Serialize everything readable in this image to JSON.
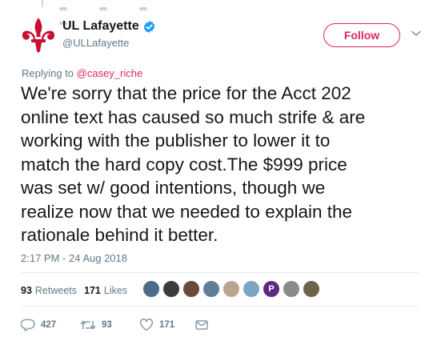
{
  "account": {
    "name": "UL Lafayette",
    "handle": "@ULLafayette",
    "verified": true,
    "follow_label": "Follow",
    "accent": "#e0245e"
  },
  "reply": {
    "prefix": "Replying to",
    "mention": "@casey_riche"
  },
  "tweet": {
    "text": "We're sorry that the price for the Acct 202\nonline text has caused so  much strife & are\nworking with the publisher to lower it to\nmatch  the hard copy cost.The $999 price\nwas set w/ good intentions, though we\nrealize now that we needed to explain the\nrationale behind it better.",
    "timestamp": "2:17 PM - 24 Aug 2018"
  },
  "stats": {
    "retweets_count": "93",
    "retweets_label": "Retweets",
    "likes_count": "171",
    "likes_label": "Likes"
  },
  "liker_avatars": [
    {
      "name": "liker-avatar-1",
      "color": "#4a6b8a",
      "glyph": ""
    },
    {
      "name": "liker-avatar-2",
      "color": "#3c3c3c",
      "glyph": ""
    },
    {
      "name": "liker-avatar-3",
      "color": "#6b4a3a",
      "glyph": ""
    },
    {
      "name": "liker-avatar-4",
      "color": "#5d7f9a",
      "glyph": ""
    },
    {
      "name": "liker-avatar-5",
      "color": "#b9a58c",
      "glyph": ""
    },
    {
      "name": "liker-avatar-6",
      "color": "#7aa6c2",
      "glyph": ""
    },
    {
      "name": "liker-avatar-7",
      "color": "#5b2a86",
      "glyph": "P"
    },
    {
      "name": "liker-avatar-8",
      "color": "#8a8a8a",
      "glyph": ""
    },
    {
      "name": "liker-avatar-9",
      "color": "#6e6248",
      "glyph": ""
    }
  ],
  "actions": {
    "reply_count": "427",
    "retweet_count": "93",
    "like_count": "171"
  },
  "icons": {
    "avatar": "fleur-de-lis-logo",
    "verified": "verified-badge-icon",
    "caret": "chevron-down-icon",
    "reply": "reply-icon",
    "retweet": "retweet-icon",
    "like": "heart-icon",
    "dm": "envelope-icon"
  }
}
